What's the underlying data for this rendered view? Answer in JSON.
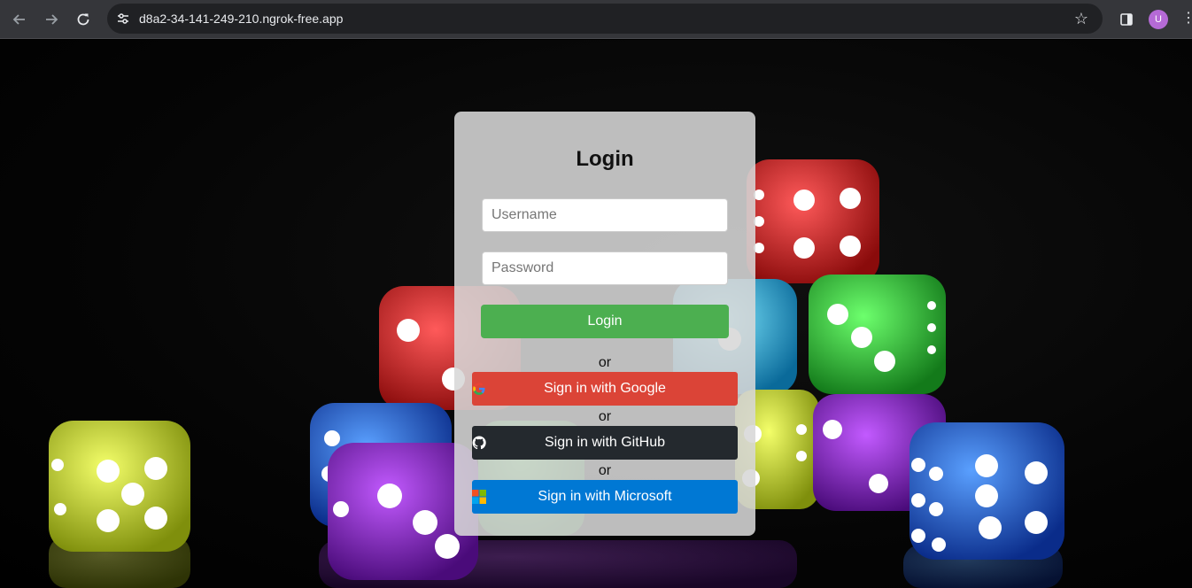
{
  "browser": {
    "url": "d8a2-34-141-249-210.ngrok-free.app",
    "profile_initial": "U",
    "icons": [
      "back-arrow-icon",
      "forward-arrow-icon",
      "reload-icon",
      "site-info-icon",
      "star-icon",
      "side-panel-icon",
      "more-menu-icon"
    ]
  },
  "login": {
    "title": "Login",
    "username_placeholder": "Username",
    "password_placeholder": "Password",
    "submit_label": "Login",
    "separator": "or",
    "google_label": "Sign in with Google",
    "github_label": "Sign in with GitHub",
    "microsoft_label": "Sign in with Microsoft"
  },
  "colors": {
    "login_button": "#4caf50",
    "google_button": "#db4437",
    "github_button": "#24292e",
    "microsoft_button": "#0078d4",
    "card_background": "#d7d7d7"
  }
}
